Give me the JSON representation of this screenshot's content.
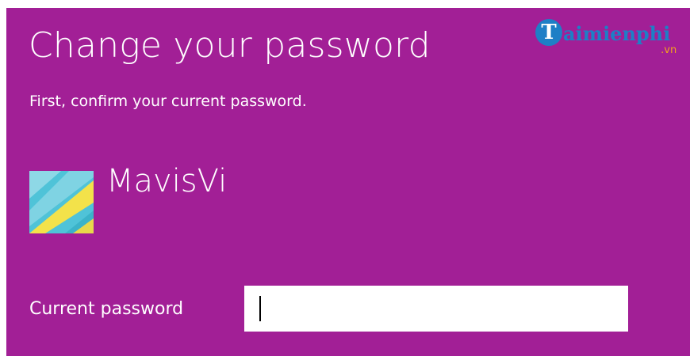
{
  "header": {
    "title": "Change your password",
    "subtitle": "First, confirm your current password."
  },
  "account": {
    "username": "MavisVi",
    "avatar_icon": "user-avatar-image",
    "avatar_text": "Taimienphi.vn"
  },
  "form": {
    "current_password_label": "Current password",
    "current_password_value": ""
  },
  "watermark": {
    "brand": "aimienphi",
    "initial": "T",
    "domain": ".vn"
  },
  "colors": {
    "background": "#a21f96",
    "text": "#ffffff",
    "input_background": "#ffffff",
    "watermark_blue": "#1e7fc6",
    "watermark_orange": "#f2a21d"
  }
}
